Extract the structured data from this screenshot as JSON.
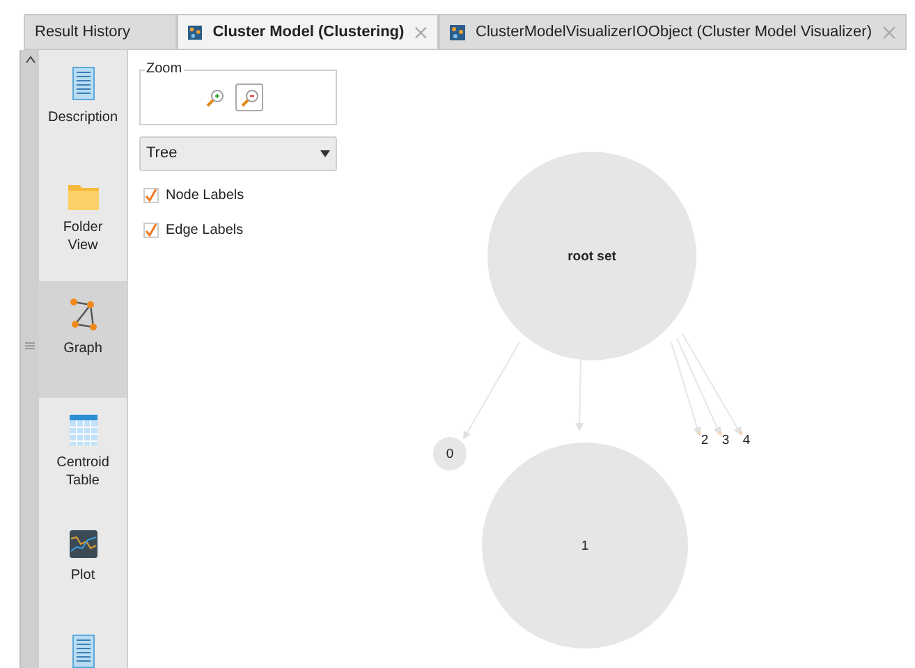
{
  "tabs": [
    {
      "label": "Result History",
      "selected": false,
      "closable": false
    },
    {
      "label": "Cluster Model (Clustering)",
      "selected": true,
      "closable": true
    },
    {
      "label": "ClusterModelVisualizerIOObject (Cluster Model Visualizer)",
      "selected": false,
      "closable": true
    }
  ],
  "sidebar": {
    "items": [
      {
        "kind": "description",
        "label": "Description",
        "selected": false
      },
      {
        "kind": "folder",
        "label": "Folder View",
        "selected": false
      },
      {
        "kind": "graph",
        "label": "Graph",
        "selected": true
      },
      {
        "kind": "table",
        "label": "Centroid Table",
        "selected": false
      },
      {
        "kind": "plot",
        "label": "Plot",
        "selected": false
      }
    ]
  },
  "zoom": {
    "title": "Zoom"
  },
  "layout_dropdown": {
    "value": "Tree"
  },
  "options": [
    {
      "label": "Node Labels",
      "checked": true
    },
    {
      "label": "Edge Labels",
      "checked": true
    }
  ],
  "graph": {
    "nodes": [
      {
        "label": "root set"
      },
      {
        "label": "0"
      },
      {
        "label": "1"
      },
      {
        "label": "2"
      },
      {
        "label": "3"
      },
      {
        "label": "4"
      }
    ]
  }
}
